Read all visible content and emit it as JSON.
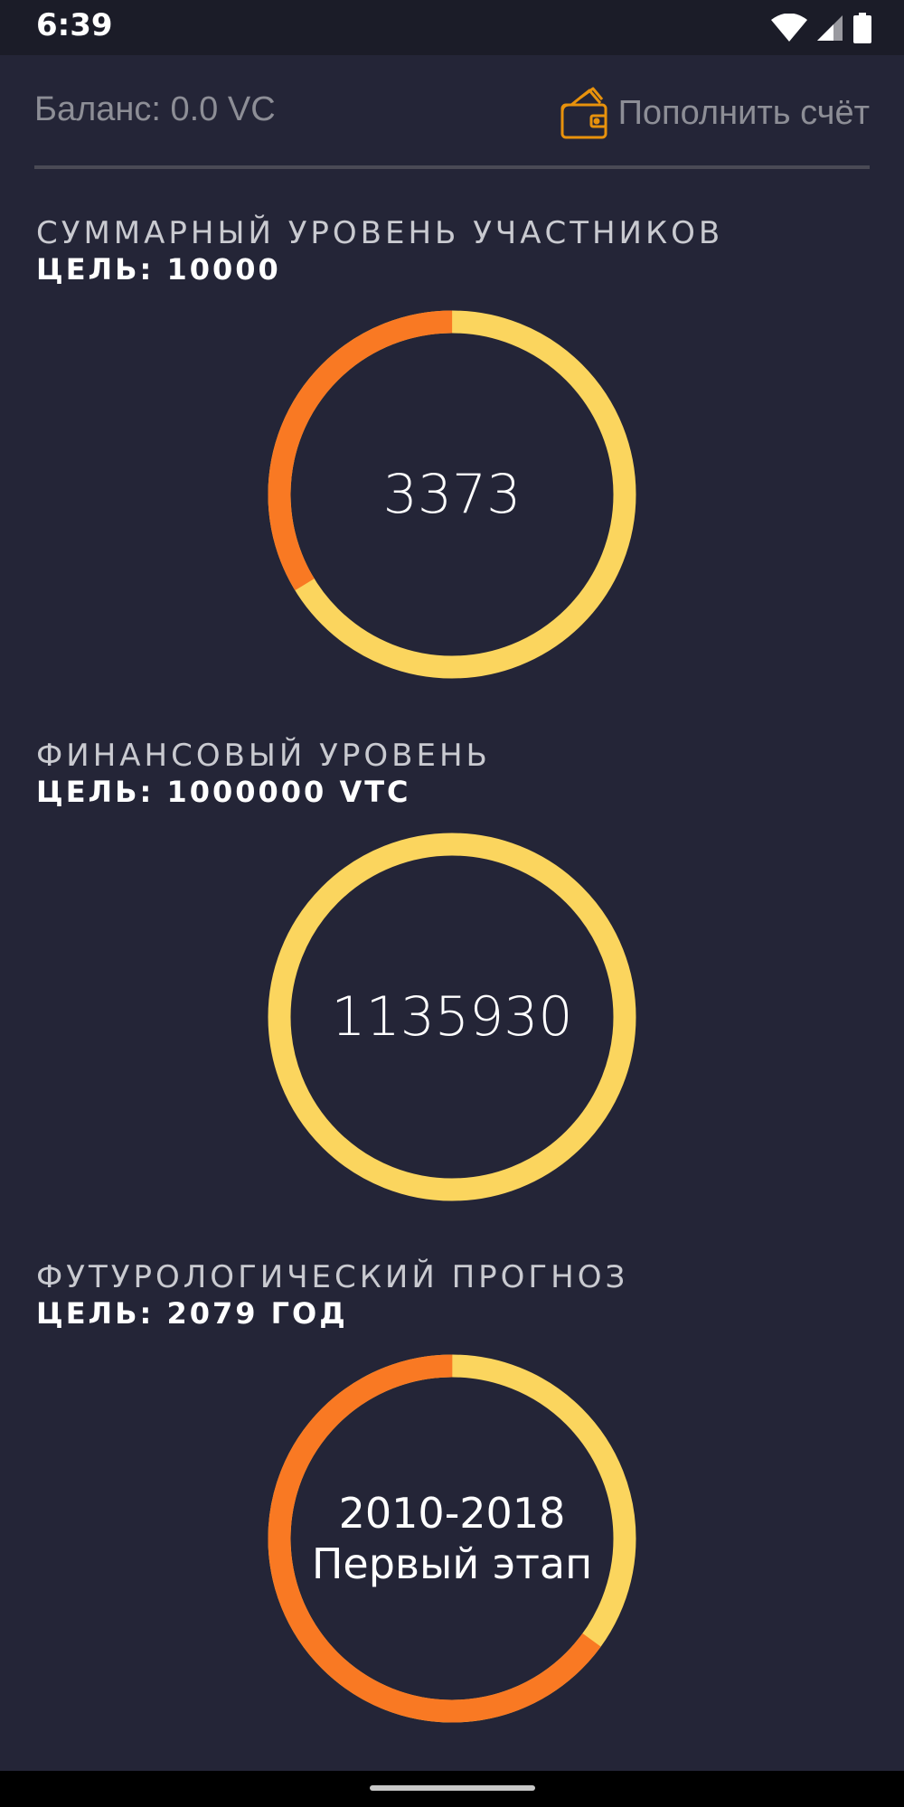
{
  "status_bar": {
    "time": "6:39",
    "icons": [
      "wifi-icon",
      "signal-icon",
      "battery-icon"
    ]
  },
  "header": {
    "balance": "Баланс: 0.0 VC",
    "topup_label": "Пополнить счёт",
    "topup_icon": "wallet-icon"
  },
  "colors": {
    "background": "#242537",
    "ring_filled": "#f97923",
    "ring_rest": "#fbd55e",
    "muted_text": "#8d8e96",
    "accent_icon": "#e8920c"
  },
  "sections": [
    {
      "title": "СУММАРНЫЙ УРОВЕНЬ УЧАСТНИКОВ",
      "goal": "ЦЕЛЬ: 10000",
      "value": "3373",
      "progress": 0.3373
    },
    {
      "title": "ФИНАНСОВЫЙ УРОВЕНЬ",
      "goal": "ЦЕЛЬ: 1000000 VTC",
      "value": "1135930",
      "progress": 1.0
    },
    {
      "title": "ФУТУРОЛОГИЧЕСКИЙ ПРОГНОЗ",
      "goal": "ЦЕЛЬ: 2079 ГОД",
      "value_line1": "2010-2018",
      "value_line2": "Первый этап",
      "progress": 0.65
    }
  ]
}
